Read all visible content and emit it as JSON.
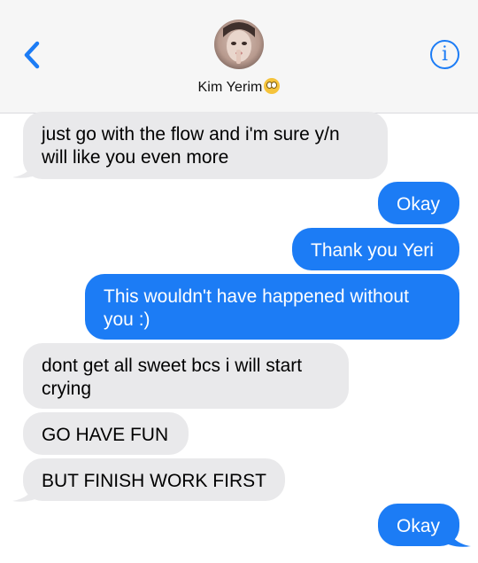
{
  "colors": {
    "incoming": "#e9e9eb",
    "outgoing": "#1c7cf5",
    "accent": "#1c7cf5"
  },
  "header": {
    "back_icon": "chevron-left-icon",
    "contact_name": "Kim Yerim",
    "contact_emoji": "face-with-rolling-eyes",
    "info_icon": "info-icon",
    "info_glyph": "i"
  },
  "messages": [
    {
      "from": "them",
      "text": "just go with the flow and i'm sure y/n will like you even more"
    },
    {
      "from": "me",
      "text": "Okay"
    },
    {
      "from": "me",
      "text": "Thank you Yeri"
    },
    {
      "from": "me",
      "text": "This wouldn't have happened without you :)"
    },
    {
      "from": "them",
      "text": "dont get all sweet bcs i will start crying"
    },
    {
      "from": "them",
      "text": "GO HAVE FUN"
    },
    {
      "from": "them",
      "text": "BUT FINISH WORK FIRST"
    },
    {
      "from": "me",
      "text": "Okay"
    }
  ]
}
